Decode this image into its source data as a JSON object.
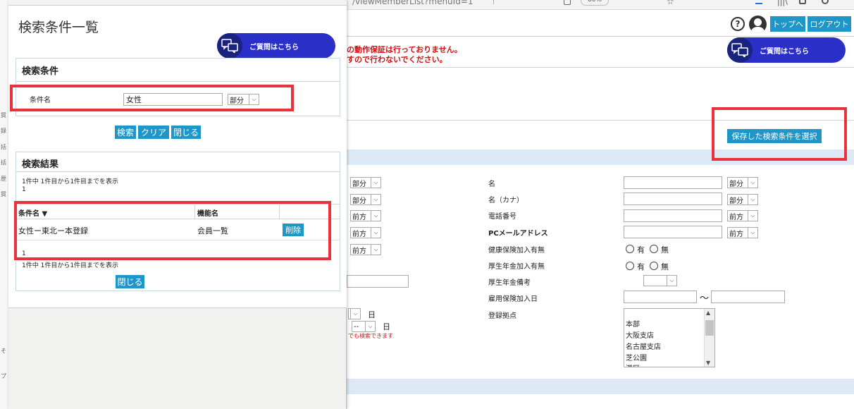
{
  "browser": {
    "url_fragment": "/viewMemberList?menuId=1",
    "zoom": "80%"
  },
  "background_page": {
    "header": {
      "help": "?",
      "top_button": "トップへ",
      "logout_button": "ログアウト"
    },
    "warnings": [
      "の動作保証は行っておりません。",
      "すので行わないでください。"
    ],
    "question_button": "ご質問はこちら",
    "saved_search_button": "保存した検索条件を選択",
    "form_left": {
      "selects": [
        "部分",
        "部分",
        "前方",
        "前方",
        "前方"
      ],
      "day_label_1": "日",
      "day_select": "--",
      "day_label_2": "日",
      "red_note": "でも検索できます"
    },
    "form_right": {
      "fields": [
        {
          "label": "名",
          "select": "部分"
        },
        {
          "label": "名（カナ）",
          "select": "部分"
        },
        {
          "label": "電話番号",
          "select": "前方"
        },
        {
          "label": "PCメールアドレス",
          "select": "前方"
        }
      ],
      "health_insurance": {
        "label": "健康保険加入有無",
        "yes": "有",
        "no": "無"
      },
      "pension": {
        "label": "厚生年金加入有無",
        "yes": "有",
        "no": "無"
      },
      "pension_note_label": "厚生年金備考",
      "employment_insurance_label": "雇用保険加入日",
      "range_sep": "〜",
      "branch_label": "登録拠点",
      "branches": [
        "本部",
        "大阪支店",
        "名古屋支店",
        "芝公園",
        "港区"
      ]
    }
  },
  "modal": {
    "title": "検索条件一覧",
    "question_button": "ご質問はこちら",
    "criteria": {
      "heading": "検索条件",
      "name_label": "条件名",
      "name_value": "女性",
      "match_select": "部分",
      "search_button": "検索",
      "clear_button": "クリア",
      "close_button": "閉じる"
    },
    "results": {
      "heading": "検索結果",
      "count_top": "1件中 1件目から1件目までを表示",
      "page_top": "1",
      "columns": [
        "条件名 ▼",
        "機能名",
        ""
      ],
      "rows": [
        {
          "name": "女性ー東北ー本登録",
          "feature": "会員一覧",
          "delete": "削除"
        }
      ],
      "page_bottom": "1",
      "count_bottom": "1件中 1件目から1件目までを表示",
      "close_button": "閉じる"
    }
  },
  "left_edge_chars": [
    "質",
    "錄",
    "括",
    "括",
    "歴",
    "質",
    "そ",
    "プ"
  ],
  "colors": {
    "accent": "#1e96c8",
    "highlight": "#e8323c",
    "warning": "#d01010",
    "question": "#2a2fc8"
  }
}
